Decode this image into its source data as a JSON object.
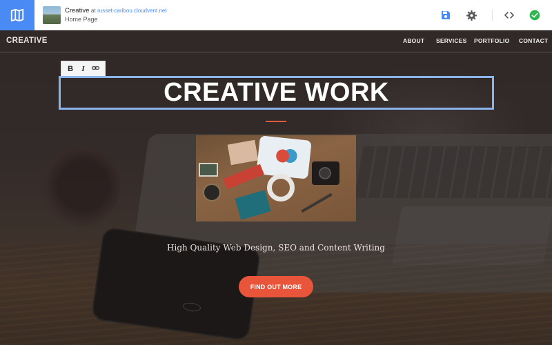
{
  "editor": {
    "site_name": "Creative",
    "at_label": "at",
    "domain": "russet-caribou.cloudvent.net",
    "page_name": "Home Page",
    "tools": [
      {
        "icon": "save-icon"
      },
      {
        "icon": "gear-icon"
      },
      {
        "icon": "code-icon"
      },
      {
        "icon": "check-circle-icon"
      }
    ],
    "accent_color": "#4a8af4",
    "success_color": "#2db84d"
  },
  "site": {
    "brand": "CREATIVE",
    "nav": [
      "ABOUT",
      "SERVICES",
      "PORTFOLIO",
      "CONTACT"
    ],
    "format_toolbar": {
      "bold": "B",
      "italic": "I",
      "link_icon": "link-icon"
    },
    "hero_title": "CREATIVE WORK",
    "tagline": "High Quality Web Design, SEO and Content Writing",
    "cta_label": "FIND OUT MORE",
    "cta_color": "#e8553b",
    "rule_color": "#e05a3c",
    "edit_outline_color": "#8ab4ec"
  }
}
